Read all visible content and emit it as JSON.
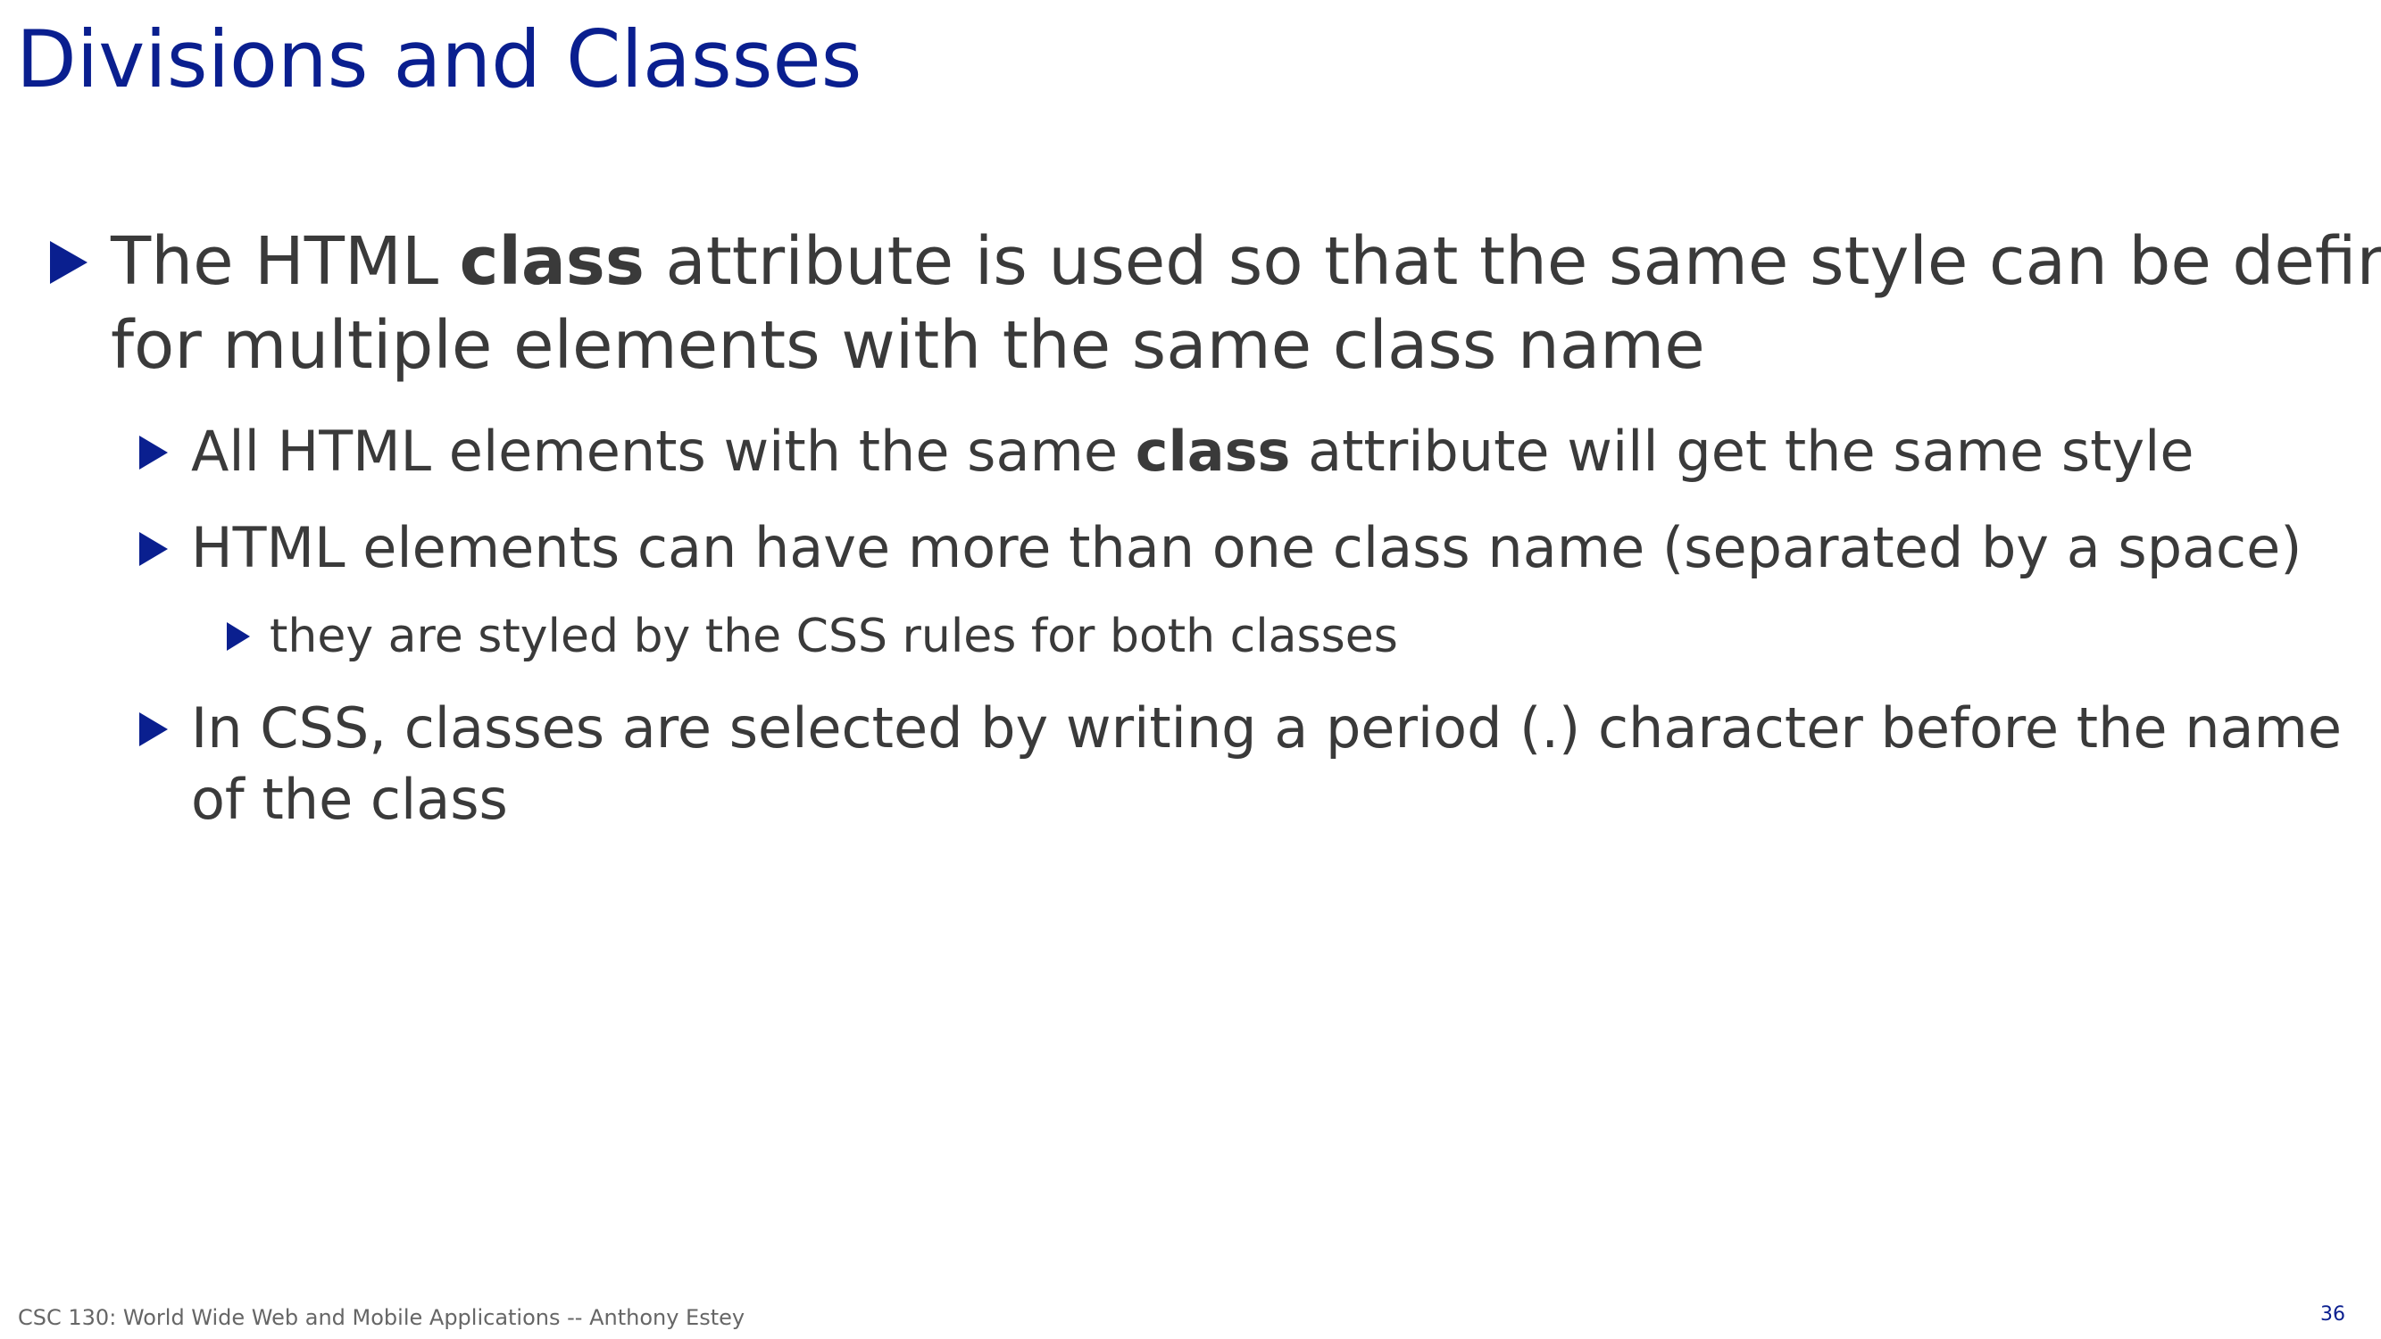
{
  "slide": {
    "title": "Divisions and Classes",
    "bullets": [
      {
        "level": 1,
        "lines": [
          [
            "The HTML ",
            "class",
            " attribute is used so that the same style can be defined"
          ],
          "for multiple elements with the same class name"
        ]
      },
      {
        "level": 2,
        "parts": [
          "All HTML elements with the same ",
          "class",
          " attribute will get the same style"
        ]
      },
      {
        "level": 2,
        "text": "HTML elements can have more than one class name (separated by a space)"
      },
      {
        "level": 3,
        "text": "they are styled by the CSS rules for both classes"
      },
      {
        "level": 2,
        "lines": [
          "In CSS, classes are selected by writing a period (.) character before the name",
          "of the class"
        ]
      }
    ],
    "footer": "CSC 130: World Wide Web and Mobile Applications -- Anthony Estey",
    "page_number": "36"
  },
  "colors": {
    "title": "#0a1f8f",
    "bullet_marker": "#0a1f8f",
    "body_text": "#3a3a3a",
    "footer_text": "#666666"
  },
  "icons": {
    "bullet_marker": "right-triangle"
  }
}
